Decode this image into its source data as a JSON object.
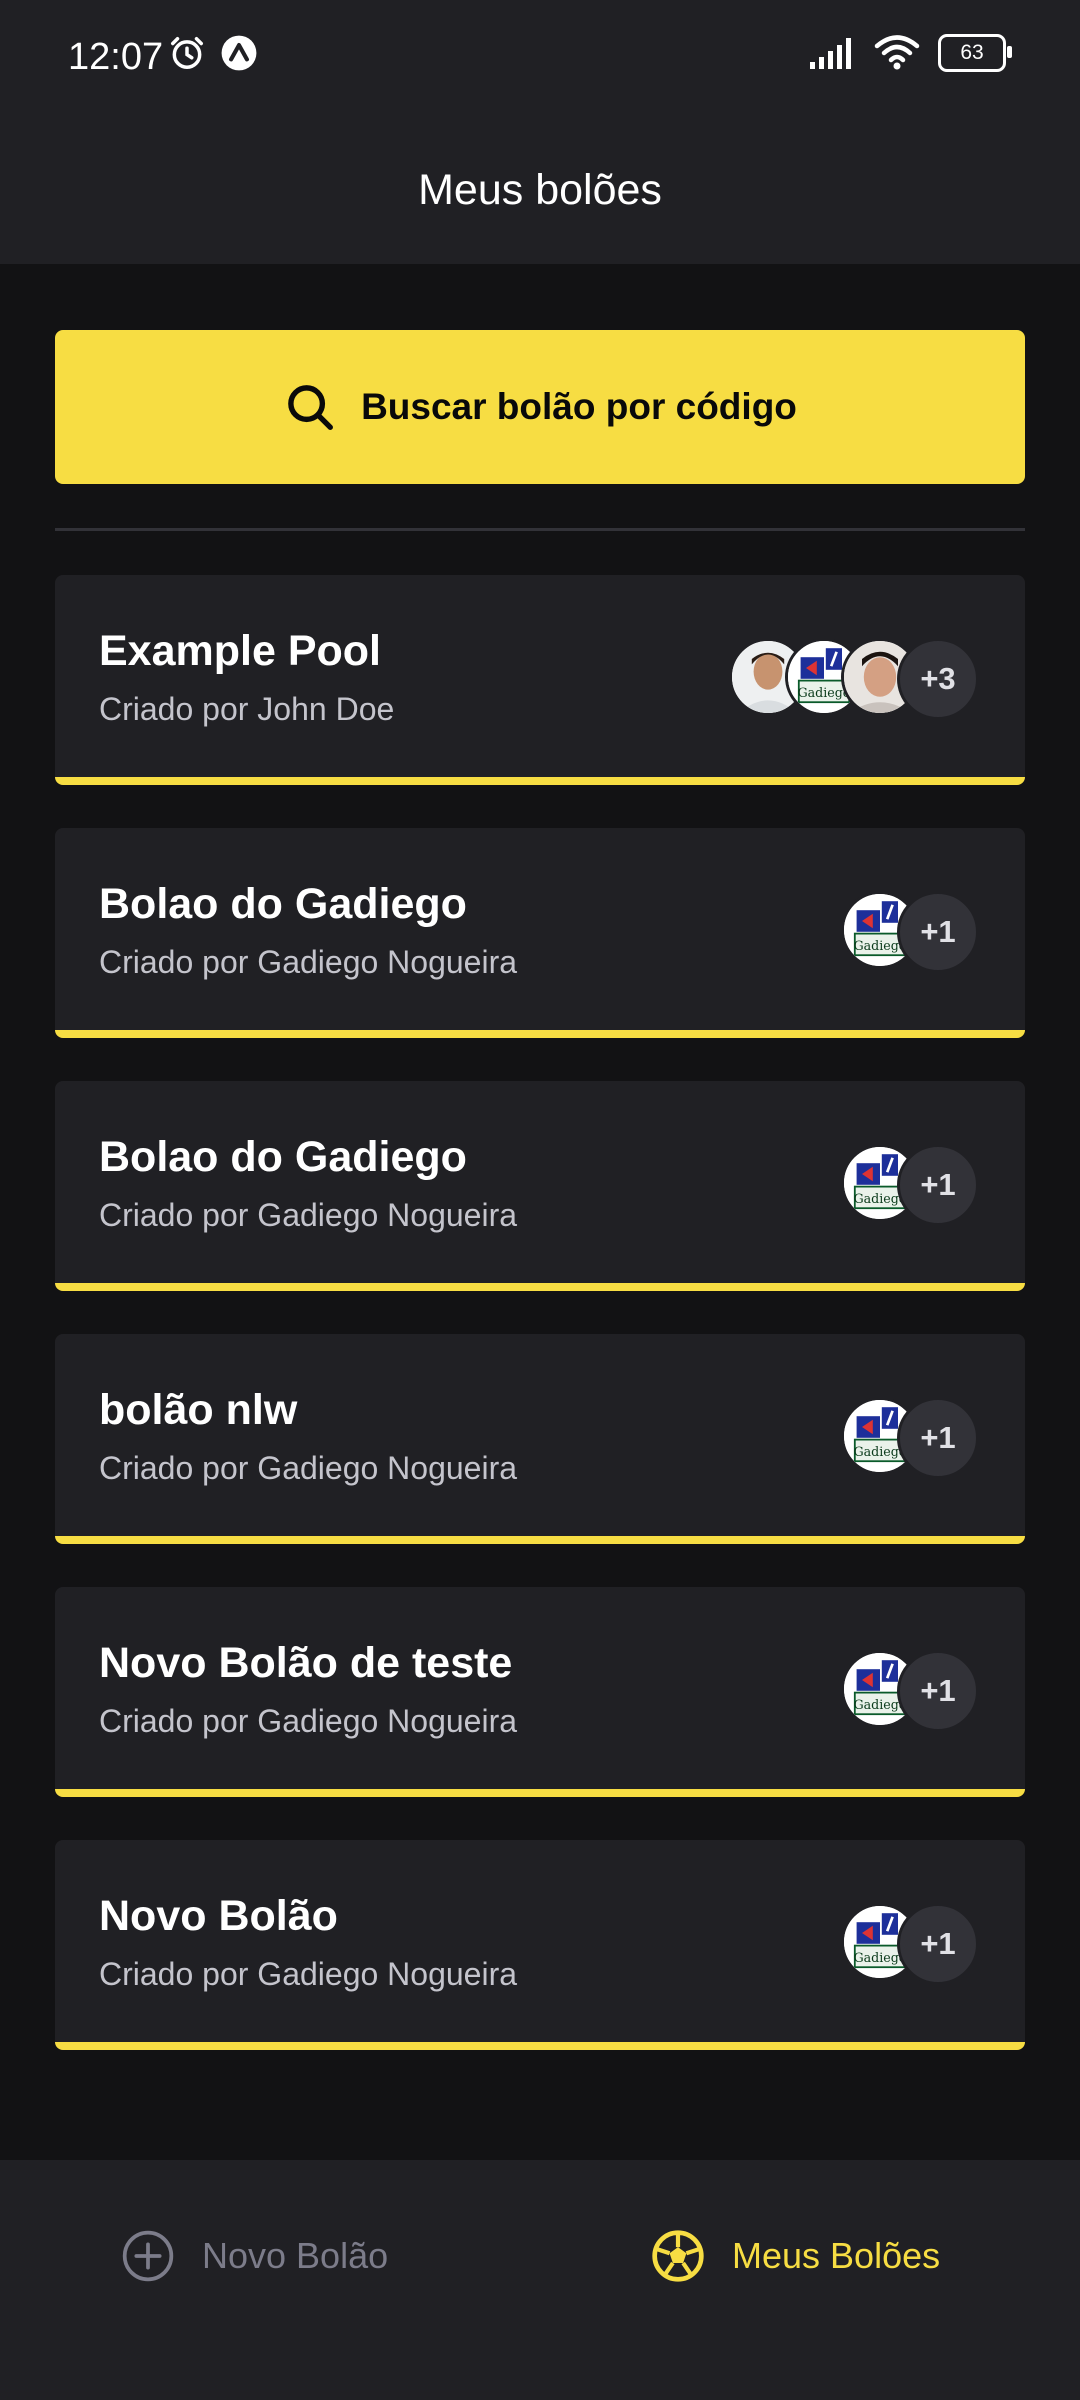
{
  "status_bar": {
    "time": "12:07",
    "battery": "63"
  },
  "header": {
    "title": "Meus bolões"
  },
  "search": {
    "label": "Buscar bolão por código"
  },
  "pools": [
    {
      "title": "Example Pool",
      "owner": "Criado por John Doe",
      "avatars": [
        "man-photo-1",
        "gadiego-logo",
        "man-photo-2"
      ],
      "extra_count": "+3"
    },
    {
      "title": "Bolao do Gadiego",
      "owner": "Criado por Gadiego Nogueira",
      "avatars": [
        "gadiego-logo"
      ],
      "extra_count": "+1"
    },
    {
      "title": "Bolao do Gadiego",
      "owner": "Criado por Gadiego Nogueira",
      "avatars": [
        "gadiego-logo"
      ],
      "extra_count": "+1"
    },
    {
      "title": "bolão nlw",
      "owner": "Criado por Gadiego Nogueira",
      "avatars": [
        "gadiego-logo"
      ],
      "extra_count": "+1"
    },
    {
      "title": "Novo Bolão de teste",
      "owner": "Criado por Gadiego Nogueira",
      "avatars": [
        "gadiego-logo"
      ],
      "extra_count": "+1"
    },
    {
      "title": "Novo Bolão",
      "owner": "Criado por Gadiego Nogueira",
      "avatars": [
        "gadiego-logo"
      ],
      "extra_count": "+1"
    }
  ],
  "tabs": {
    "new_pool": {
      "label": "Novo Bolão",
      "icon": "plus-circle-icon"
    },
    "my_pools": {
      "label": "Meus Bolões",
      "icon": "soccer-ball-icon"
    }
  },
  "colors": {
    "accent": "#F7DD43",
    "background": "#121214",
    "surface": "#202024",
    "muted": "#7C7C8A"
  }
}
